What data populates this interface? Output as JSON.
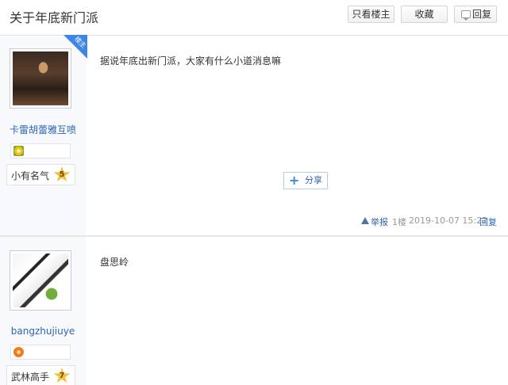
{
  "header": {
    "title": "关于年底新门派",
    "only_lz_label": "只看楼主",
    "favorite_label": "收藏",
    "reply_label": "回复"
  },
  "posts": [
    {
      "badge": "楼主",
      "username": "卡雷胡蕾雅互喷",
      "level_name": "小有名气",
      "level_num": "5",
      "text": "据说年底出新门派，大家有什么小道消息嘛",
      "share_label": "分享",
      "report_label": "举报",
      "floor": "1楼",
      "time": "2019-10-07 15:22",
      "reply_label": "回复"
    },
    {
      "username": "bangzhujiuye",
      "level_name": "武林高手",
      "level_num": "7",
      "text": "盘思岭"
    }
  ],
  "colors": {
    "link": "#2d64b3",
    "badge": "#3e86e6",
    "star": "#f2c03a"
  }
}
